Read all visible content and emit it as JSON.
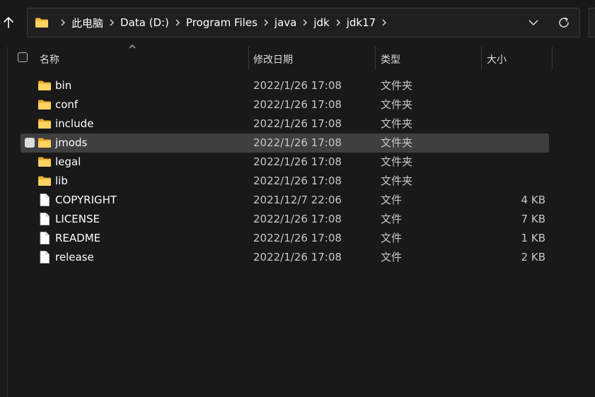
{
  "address_bar": {
    "breadcrumbs": [
      "此电脑",
      "Data (D:)",
      "Program Files",
      "java",
      "jdk",
      "jdk17"
    ],
    "icons": {
      "up": "arrow-up-icon",
      "location": "folder-icon",
      "separator": "chevron-right-icon",
      "history": "chevron-down-icon",
      "refresh": "refresh-icon"
    }
  },
  "columns": {
    "name": "名称",
    "date_modified": "修改日期",
    "type": "类型",
    "size": "大小",
    "sorted_by": "name"
  },
  "files": [
    {
      "name": "bin",
      "date": "2022/1/26 17:08",
      "type": "文件夹",
      "size": "",
      "icon": "folder-icon"
    },
    {
      "name": "conf",
      "date": "2022/1/26 17:08",
      "type": "文件夹",
      "size": "",
      "icon": "folder-icon"
    },
    {
      "name": "include",
      "date": "2022/1/26 17:08",
      "type": "文件夹",
      "size": "",
      "icon": "folder-icon"
    },
    {
      "name": "jmods",
      "date": "2022/1/26 17:08",
      "type": "文件夹",
      "size": "",
      "icon": "folder-icon",
      "hovered": true
    },
    {
      "name": "legal",
      "date": "2022/1/26 17:08",
      "type": "文件夹",
      "size": "",
      "icon": "folder-icon"
    },
    {
      "name": "lib",
      "date": "2022/1/26 17:08",
      "type": "文件夹",
      "size": "",
      "icon": "folder-icon"
    },
    {
      "name": "COPYRIGHT",
      "date": "2021/12/7 22:06",
      "type": "文件",
      "size": "4 KB",
      "icon": "file-icon"
    },
    {
      "name": "LICENSE",
      "date": "2022/1/26 17:08",
      "type": "文件",
      "size": "7 KB",
      "icon": "file-icon"
    },
    {
      "name": "README",
      "date": "2022/1/26 17:08",
      "type": "文件",
      "size": "1 KB",
      "icon": "file-icon"
    },
    {
      "name": "release",
      "date": "2022/1/26 17:08",
      "type": "文件",
      "size": "2 KB",
      "icon": "file-icon"
    }
  ],
  "colors": {
    "background": "#191919",
    "hover_row": "#3f3f3f",
    "folder_yellow": "#f8c94a"
  }
}
